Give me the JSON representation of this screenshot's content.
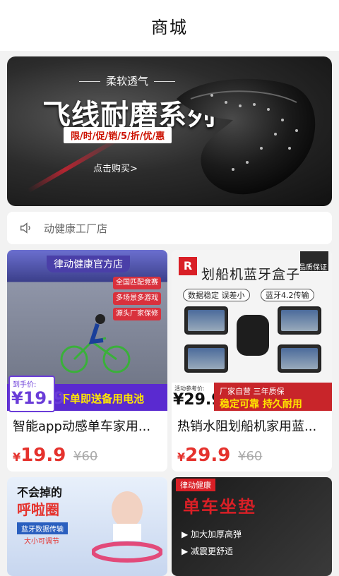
{
  "header": {
    "title": "商城"
  },
  "banner": {
    "tagline": "柔软透气",
    "headline": "飞线耐磨系列",
    "promo": "限/时/促/销/5/折/优/惠",
    "cta": "点击购买>",
    "dots": 3,
    "active_dot": 0,
    "accent_color": "#e5322d"
  },
  "notice": {
    "icon": "speaker-icon",
    "text": "动健康工厂店"
  },
  "products": [
    {
      "name": "智能app动感单车家用...",
      "price_symbol": "¥",
      "price": "19.9",
      "original_price": "¥60",
      "image": {
        "shop": "律动健康官方店",
        "bullets": [
          "全国匹配竞赛",
          "多场景多游戏",
          "源头厂家保修"
        ],
        "price_label": "到手价:",
        "price_value": "¥19.9",
        "slogan": "下单即送备用电池"
      }
    },
    {
      "name": "热销水阻划船机家用蓝...",
      "price_symbol": "¥",
      "price": "29.9",
      "original_price": "¥60",
      "image": {
        "logo": "R",
        "headline": "划船机蓝牙盒子",
        "badge": "品质保证",
        "features": [
          "数据稳定 误差小",
          "蓝牙4.2传输"
        ],
        "price_label": "活动参考价:",
        "price_value": "¥29.9",
        "strip_line1": "厂家自营 三年质保",
        "strip_line2": "稳定可靠 持久耐用"
      }
    },
    {
      "name": "",
      "image": {
        "line1": "不会掉的",
        "line2": "呼啦圈",
        "line3": "蓝牙数据传输",
        "line4": "大小可调节"
      }
    },
    {
      "name": "",
      "image": {
        "logo": "律动健康",
        "headline": "单车坐垫",
        "features": [
          "▶ 加大加厚高弹",
          "▶ 减震更舒适"
        ]
      }
    }
  ]
}
